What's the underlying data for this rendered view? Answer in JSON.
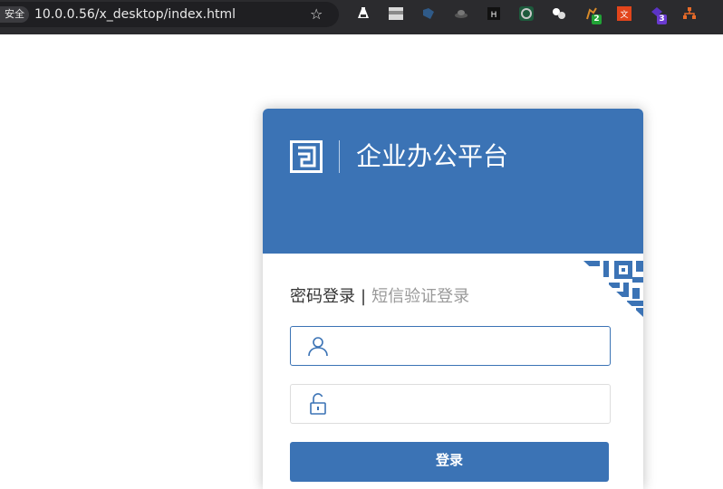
{
  "browser": {
    "security_label": "安全",
    "url": "10.0.0.56/x_desktop/index.html",
    "extensions": [
      {
        "name": "flask-extension-icon"
      },
      {
        "name": "window-extension-icon"
      },
      {
        "name": "paint-extension-icon"
      },
      {
        "name": "hat-extension-icon"
      },
      {
        "name": "h-extension-icon"
      },
      {
        "name": "circle-extension-icon"
      },
      {
        "name": "bubbles-extension-icon"
      },
      {
        "name": "plant-extension-icon",
        "badge": "2",
        "badge_color": "#21a336"
      },
      {
        "name": "translate-extension-icon"
      },
      {
        "name": "shapes-extension-icon",
        "badge": "3",
        "badge_color": "#6a3ad0"
      },
      {
        "name": "tree-extension-icon"
      }
    ]
  },
  "login": {
    "app_title": "企业办公平台",
    "tabs": {
      "password": "密码登录",
      "separator": "|",
      "sms": "短信验证登录"
    },
    "username_placeholder": "",
    "password_placeholder": "",
    "submit_label": "登录"
  },
  "colors": {
    "brand": "#3b73b5"
  }
}
